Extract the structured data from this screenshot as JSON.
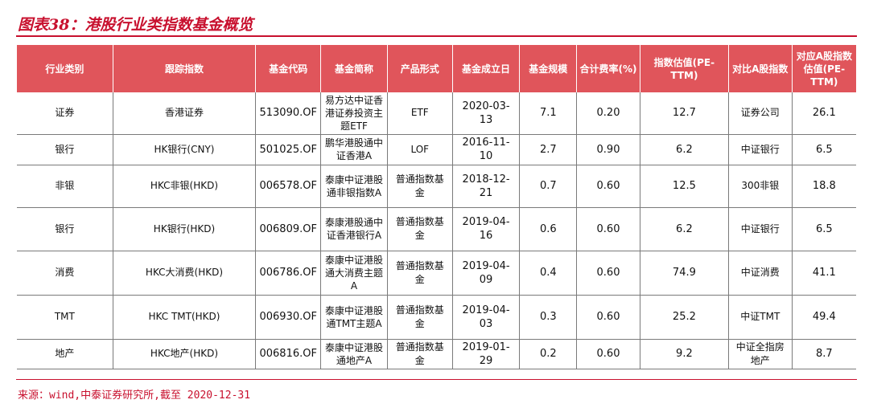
{
  "title": "图表38：港股行业类指数基金概览",
  "source": "来源：wind,中泰证券研究所,截至 2020-12-31",
  "colors": {
    "accent": "#c8102e",
    "header_bg": "#e0555b",
    "header_text": "#ffffff"
  },
  "chart_data": {
    "type": "table",
    "title": "图表38：港股行业类指数基金概览",
    "columns": [
      "行业类别",
      "跟踪指数",
      "基金代码",
      "基金简称",
      "产品形式",
      "基金成立日",
      "基金规模",
      "合计费率(%)",
      "指数估值(PE-TTM)",
      "对比A股指数",
      "对应A股指数估值(PE-TTM)"
    ],
    "rows": [
      [
        "证券",
        "香港证券",
        "513090.OF",
        "易方达中证香港证券投资主题ETF",
        "ETF",
        "2020-03-13",
        "7.1",
        "0.20",
        "12.7",
        "证券公司",
        "26.1"
      ],
      [
        "银行",
        "HK银行(CNY)",
        "501025.OF",
        "鹏华港股通中证香港A",
        "LOF",
        "2016-11-10",
        "2.7",
        "0.90",
        "6.2",
        "中证银行",
        "6.5"
      ],
      [
        "非银",
        "HKC非银(HKD)",
        "006578.OF",
        "泰康中证港股通非银指数A",
        "普通指数基金",
        "2018-12-21",
        "0.7",
        "0.60",
        "12.5",
        "300非银",
        "18.8"
      ],
      [
        "银行",
        "HK银行(HKD)",
        "006809.OF",
        "泰康港股通中证香港银行A",
        "普通指数基金",
        "2019-04-16",
        "0.6",
        "0.60",
        "6.2",
        "中证银行",
        "6.5"
      ],
      [
        "消费",
        "HKC大消费(HKD)",
        "006786.OF",
        "泰康中证港股通大消费主题A",
        "普通指数基金",
        "2019-04-09",
        "0.4",
        "0.60",
        "74.9",
        "中证消费",
        "41.1"
      ],
      [
        "TMT",
        "HKC TMT(HKD)",
        "006930.OF",
        "泰康中证港股通TMT主题A",
        "普通指数基金",
        "2019-04-03",
        "0.3",
        "0.60",
        "25.2",
        "中证TMT",
        "49.4"
      ],
      [
        "地产",
        "HKC地产(HKD)",
        "006816.OF",
        "泰康中证港股通地产A",
        "普通指数基金",
        "2019-01-29",
        "0.2",
        "0.60",
        "9.2",
        "中证全指房地产",
        "8.7"
      ]
    ]
  }
}
